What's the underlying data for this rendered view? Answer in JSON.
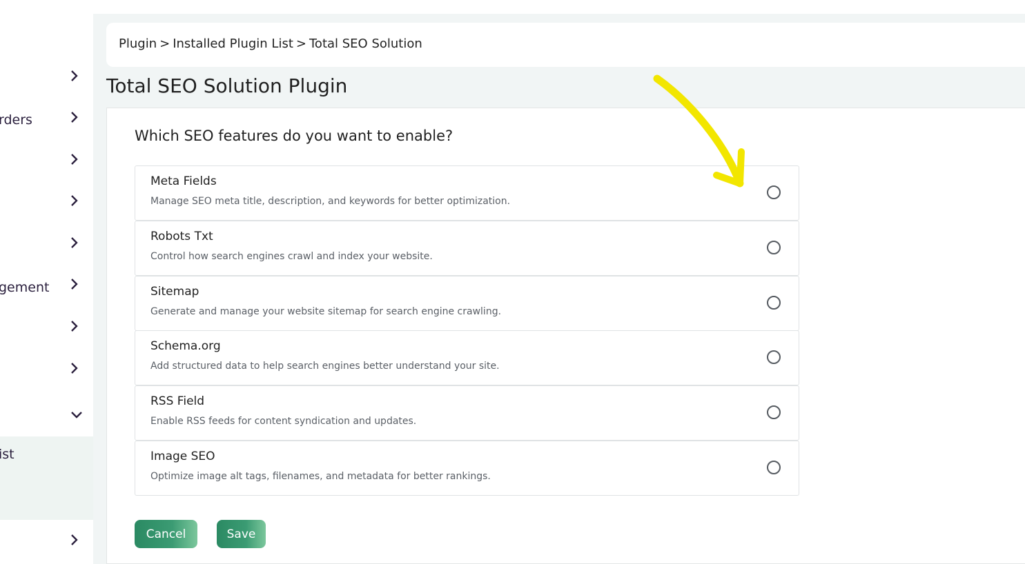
{
  "sidebar": {
    "items": [
      {
        "label": "",
        "expanded": false
      },
      {
        "label": "rders",
        "expanded": false
      },
      {
        "label": "",
        "expanded": false
      },
      {
        "label": "",
        "expanded": false
      },
      {
        "label": "",
        "expanded": false
      },
      {
        "label": "gement",
        "expanded": false
      },
      {
        "label": "",
        "expanded": false
      },
      {
        "label": "",
        "expanded": false
      },
      {
        "label": "",
        "expanded": true
      },
      {
        "label": "",
        "expanded": false
      }
    ],
    "active_item_label": "ist"
  },
  "breadcrumb": {
    "items": [
      "Plugin",
      "Installed Plugin List",
      "Total SEO Solution"
    ],
    "separator": ">"
  },
  "page": {
    "title": "Total SEO Solution Plugin",
    "question": "Which SEO features do you want to enable?"
  },
  "options": [
    {
      "title": "Meta Fields",
      "description": "Manage SEO meta title, description, and keywords for better optimization.",
      "selected": false
    },
    {
      "title": "Robots Txt",
      "description": "Control how search engines crawl and index your website.",
      "selected": false
    },
    {
      "title": "Sitemap",
      "description": "Generate and manage your website sitemap for search engine crawling.",
      "selected": false
    },
    {
      "title": "Schema.org",
      "description": "Add structured data to help search engines better understand your site.",
      "selected": false
    },
    {
      "title": "RSS Field",
      "description": "Enable RSS feeds for content syndication and updates.",
      "selected": false
    },
    {
      "title": "Image SEO",
      "description": "Optimize image alt tags, filenames, and metadata for better rankings.",
      "selected": false
    }
  ],
  "actions": {
    "cancel_label": "Cancel",
    "save_label": "Save"
  },
  "colors": {
    "accent": "#2b8a63",
    "annotation": "#f2e600",
    "background": "#f1f5f5"
  }
}
